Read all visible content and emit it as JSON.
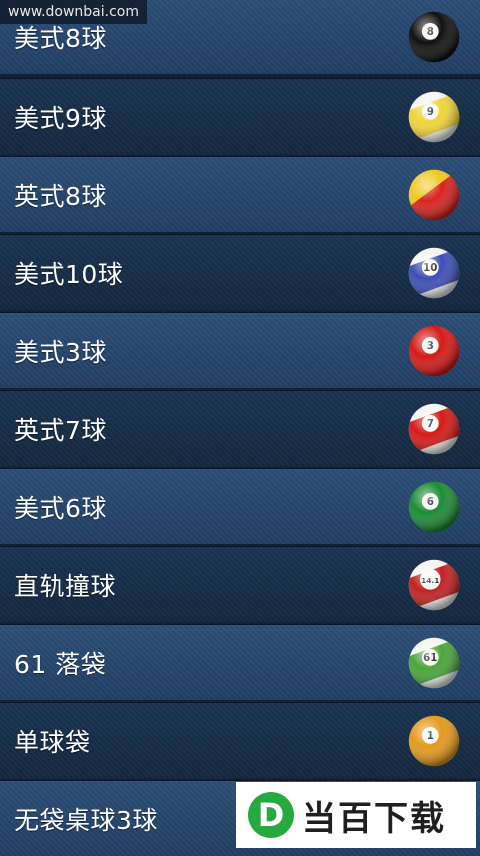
{
  "watermark": "www.downbai.com",
  "items": [
    {
      "label": "美式8球",
      "ball": {
        "number": "8",
        "color": "#111111",
        "stripe": false
      }
    },
    {
      "label": "美式9球",
      "ball": {
        "number": "9",
        "color": "#f0d33a",
        "stripe": true
      }
    },
    {
      "label": "英式8球",
      "ball": {
        "number": "",
        "color": "#d9231f",
        "stripe": false,
        "half_color": "#f0c822"
      }
    },
    {
      "label": "美式10球",
      "ball": {
        "number": "10",
        "color": "#3d4fb8",
        "stripe": true
      }
    },
    {
      "label": "美式3球",
      "ball": {
        "number": "3",
        "color": "#d51a18",
        "stripe": false
      }
    },
    {
      "label": "英式7球",
      "ball": {
        "number": "7",
        "color": "#d51a18",
        "stripe": true
      }
    },
    {
      "label": "美式6球",
      "ball": {
        "number": "6",
        "color": "#1c8c34",
        "stripe": false
      }
    },
    {
      "label": "直轨撞球",
      "ball": {
        "number": "14.1",
        "color": "#c22222",
        "stripe": true
      }
    },
    {
      "label": "61 落袋",
      "ball": {
        "number": "61",
        "color": "#4aa63a",
        "stripe": true
      }
    },
    {
      "label": "单球袋",
      "ball": {
        "number": "1",
        "color": "#e39a1e",
        "stripe": false
      }
    },
    {
      "label": "无袋桌球3球",
      "ball": {
        "number": "",
        "color": "#ffffff",
        "stripe": false
      }
    }
  ],
  "brand": {
    "logo_letter": "D",
    "name": "当百下载",
    "logo_color": "#26a93f"
  }
}
